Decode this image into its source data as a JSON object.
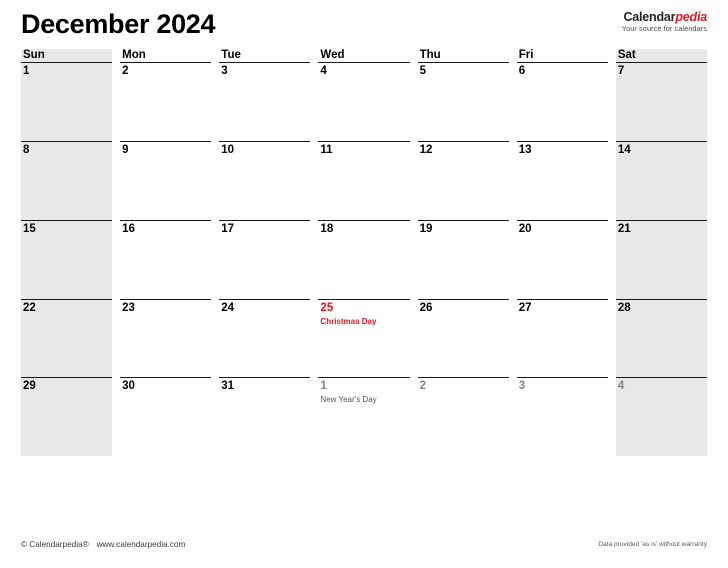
{
  "header": {
    "title": "December 2024",
    "brand_black": "Calendar",
    "brand_red": "pedia",
    "brand_tagline": "Your source for calendars"
  },
  "weekdays": [
    {
      "label": "Sun",
      "weekend": true
    },
    {
      "label": "Mon",
      "weekend": false
    },
    {
      "label": "Tue",
      "weekend": false
    },
    {
      "label": "Wed",
      "weekend": false
    },
    {
      "label": "Thu",
      "weekend": false
    },
    {
      "label": "Fri",
      "weekend": false
    },
    {
      "label": "Sat",
      "weekend": true
    }
  ],
  "weeks": [
    [
      {
        "day": "1",
        "weekend": true,
        "other": false,
        "holiday": false,
        "event": ""
      },
      {
        "day": "2",
        "weekend": false,
        "other": false,
        "holiday": false,
        "event": ""
      },
      {
        "day": "3",
        "weekend": false,
        "other": false,
        "holiday": false,
        "event": ""
      },
      {
        "day": "4",
        "weekend": false,
        "other": false,
        "holiday": false,
        "event": ""
      },
      {
        "day": "5",
        "weekend": false,
        "other": false,
        "holiday": false,
        "event": ""
      },
      {
        "day": "6",
        "weekend": false,
        "other": false,
        "holiday": false,
        "event": ""
      },
      {
        "day": "7",
        "weekend": true,
        "other": false,
        "holiday": false,
        "event": ""
      }
    ],
    [
      {
        "day": "8",
        "weekend": true,
        "other": false,
        "holiday": false,
        "event": ""
      },
      {
        "day": "9",
        "weekend": false,
        "other": false,
        "holiday": false,
        "event": ""
      },
      {
        "day": "10",
        "weekend": false,
        "other": false,
        "holiday": false,
        "event": ""
      },
      {
        "day": "11",
        "weekend": false,
        "other": false,
        "holiday": false,
        "event": ""
      },
      {
        "day": "12",
        "weekend": false,
        "other": false,
        "holiday": false,
        "event": ""
      },
      {
        "day": "13",
        "weekend": false,
        "other": false,
        "holiday": false,
        "event": ""
      },
      {
        "day": "14",
        "weekend": true,
        "other": false,
        "holiday": false,
        "event": ""
      }
    ],
    [
      {
        "day": "15",
        "weekend": true,
        "other": false,
        "holiday": false,
        "event": ""
      },
      {
        "day": "16",
        "weekend": false,
        "other": false,
        "holiday": false,
        "event": ""
      },
      {
        "day": "17",
        "weekend": false,
        "other": false,
        "holiday": false,
        "event": ""
      },
      {
        "day": "18",
        "weekend": false,
        "other": false,
        "holiday": false,
        "event": ""
      },
      {
        "day": "19",
        "weekend": false,
        "other": false,
        "holiday": false,
        "event": ""
      },
      {
        "day": "20",
        "weekend": false,
        "other": false,
        "holiday": false,
        "event": ""
      },
      {
        "day": "21",
        "weekend": true,
        "other": false,
        "holiday": false,
        "event": ""
      }
    ],
    [
      {
        "day": "22",
        "weekend": true,
        "other": false,
        "holiday": false,
        "event": ""
      },
      {
        "day": "23",
        "weekend": false,
        "other": false,
        "holiday": false,
        "event": ""
      },
      {
        "day": "24",
        "weekend": false,
        "other": false,
        "holiday": false,
        "event": ""
      },
      {
        "day": "25",
        "weekend": false,
        "other": false,
        "holiday": true,
        "event": "Christmas Day"
      },
      {
        "day": "26",
        "weekend": false,
        "other": false,
        "holiday": false,
        "event": ""
      },
      {
        "day": "27",
        "weekend": false,
        "other": false,
        "holiday": false,
        "event": ""
      },
      {
        "day": "28",
        "weekend": true,
        "other": false,
        "holiday": false,
        "event": ""
      }
    ],
    [
      {
        "day": "29",
        "weekend": true,
        "other": false,
        "holiday": false,
        "event": ""
      },
      {
        "day": "30",
        "weekend": false,
        "other": false,
        "holiday": false,
        "event": ""
      },
      {
        "day": "31",
        "weekend": false,
        "other": false,
        "holiday": false,
        "event": ""
      },
      {
        "day": "1",
        "weekend": false,
        "other": true,
        "holiday": false,
        "event": "New Year's Day",
        "event_muted": true
      },
      {
        "day": "2",
        "weekend": false,
        "other": true,
        "holiday": false,
        "event": ""
      },
      {
        "day": "3",
        "weekend": false,
        "other": true,
        "holiday": false,
        "event": ""
      },
      {
        "day": "4",
        "weekend": true,
        "other": true,
        "holiday": false,
        "event": ""
      }
    ]
  ],
  "footer": {
    "copyright": "© Calendarpedia®",
    "website": "www.calendarpedia.com",
    "disclaimer": "Data provided 'as is' without warranty"
  }
}
